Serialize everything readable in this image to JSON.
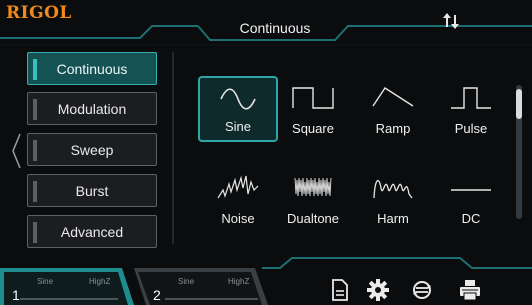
{
  "header": {
    "logo": "RIGOL",
    "title": "Continuous"
  },
  "sidebar": {
    "items": [
      {
        "label": "Continuous",
        "active": true
      },
      {
        "label": "Modulation",
        "active": false
      },
      {
        "label": "Sweep",
        "active": false
      },
      {
        "label": "Burst",
        "active": false
      },
      {
        "label": "Advanced",
        "active": false
      }
    ]
  },
  "waveforms": [
    {
      "label": "Sine",
      "icon": "sine-wave-icon",
      "selected": true
    },
    {
      "label": "Square",
      "icon": "square-wave-icon",
      "selected": false
    },
    {
      "label": "Ramp",
      "icon": "ramp-wave-icon",
      "selected": false
    },
    {
      "label": "Pulse",
      "icon": "pulse-wave-icon",
      "selected": false
    },
    {
      "label": "Noise",
      "icon": "noise-wave-icon",
      "selected": false
    },
    {
      "label": "Dualtone",
      "icon": "dualtone-wave-icon",
      "selected": false
    },
    {
      "label": "Harm",
      "icon": "harmonic-wave-icon",
      "selected": false
    },
    {
      "label": "DC",
      "icon": "dc-wave-icon",
      "selected": false
    }
  ],
  "channels": [
    {
      "number": "1",
      "waveform": "Sine",
      "impedance": "HighZ"
    },
    {
      "number": "2",
      "waveform": "Sine",
      "impedance": "HighZ"
    }
  ],
  "colors": {
    "accent": "#2ea6a8",
    "logo": "#f28a1a",
    "channel1": "#1f8c8e",
    "channel2": "#3a3f44"
  }
}
